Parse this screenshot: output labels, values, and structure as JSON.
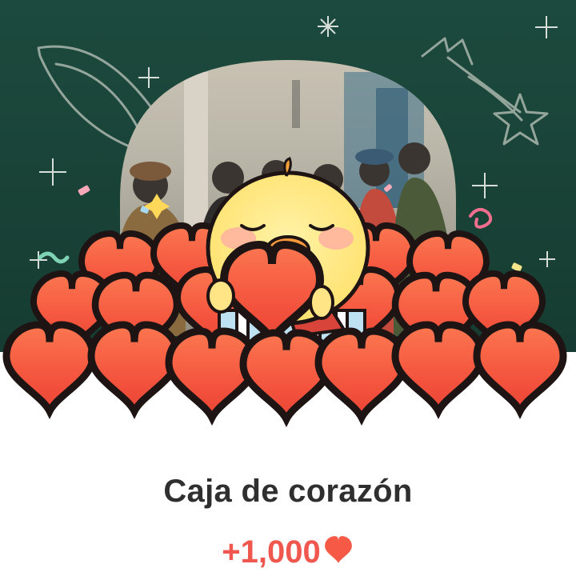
{
  "card": {
    "title": "Caja de corazón",
    "reward_amount": "+1,000",
    "reward_icon": "heart-icon"
  },
  "illustration": {
    "mascot": "yellow-chick-holding-heart",
    "background": "group-photo-with-star-doodles",
    "accent_green": "#173c33",
    "heart_color": "#f6543f"
  }
}
